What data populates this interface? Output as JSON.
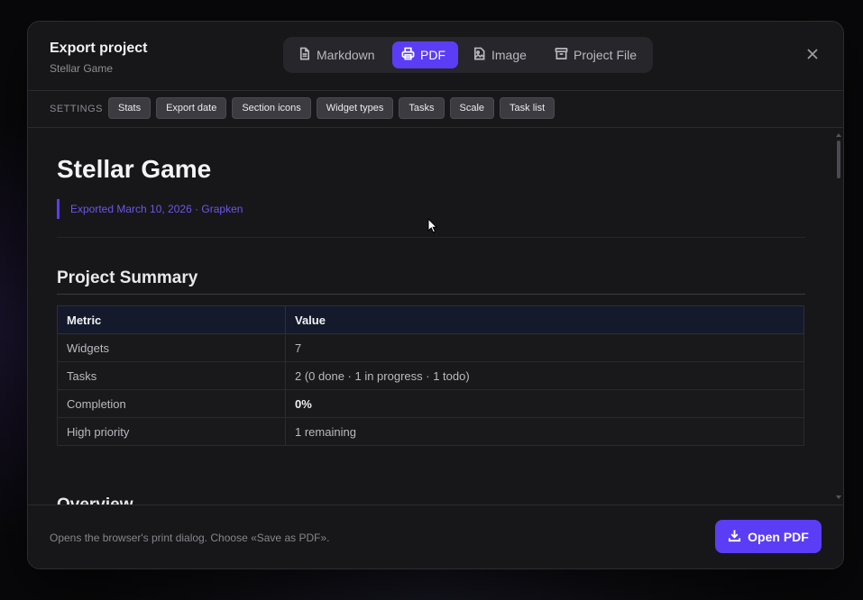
{
  "dialog": {
    "title": "Export project",
    "subtitle": "Stellar Game",
    "close_icon": "close-icon"
  },
  "tabs": [
    {
      "label": "Markdown",
      "icon": "document-icon",
      "active": false
    },
    {
      "label": "PDF",
      "icon": "printer-icon",
      "active": true
    },
    {
      "label": "Image",
      "icon": "image-icon",
      "active": false
    },
    {
      "label": "Project File",
      "icon": "archive-icon",
      "active": false
    }
  ],
  "settings": {
    "label": "SETTINGS",
    "chips": [
      "Stats",
      "Export date",
      "Section icons",
      "Widget types",
      "Tasks",
      "Scale",
      "Task list"
    ]
  },
  "preview": {
    "title": "Stellar Game",
    "export_line": "Exported March 10, 2026 · Grapken",
    "summary_heading": "Project Summary",
    "summary_table": {
      "headers": [
        "Metric",
        "Value"
      ],
      "rows": [
        [
          "Widgets",
          "7"
        ],
        [
          "Tasks",
          "2 (0 done · 1 in progress · 1 todo)"
        ],
        [
          "Completion",
          "0%"
        ],
        [
          "High priority",
          "1 remaining"
        ]
      ]
    },
    "overview_heading": "Overview"
  },
  "footer": {
    "note": "Opens the browser's print dialog. Choose «Save as PDF».",
    "primary_label": "Open PDF",
    "primary_icon": "download-icon"
  },
  "colors": {
    "accent": "#5b3df5",
    "background": "#17171a"
  }
}
